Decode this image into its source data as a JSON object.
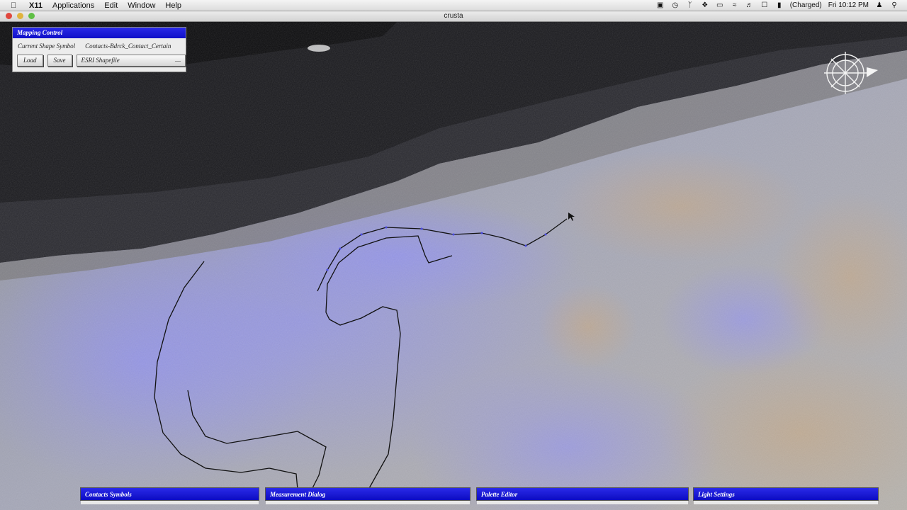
{
  "menubar": {
    "app": "X11",
    "items": [
      "Applications",
      "Edit",
      "Window",
      "Help"
    ],
    "battery": "(Charged)",
    "clock": "Fri 10:12 PM"
  },
  "window": {
    "title": "crusta"
  },
  "mapping_control": {
    "title": "Mapping Control",
    "shape_label": "Current Shape Symbol",
    "shape_value": "Contacts-Bdrck_Contact_Certain",
    "load_label": "Load",
    "save_label": "Save",
    "format_value": "ESRI Shapefile"
  },
  "bottom_bars": {
    "contacts": "Contacts Symbols",
    "measurement": "Measurement Dialog",
    "palette": "Palette Editor",
    "light": "Light Settings"
  },
  "colors": {
    "panel_header": "#1a1ad8",
    "terrain_overlay": "#8f8fff"
  }
}
